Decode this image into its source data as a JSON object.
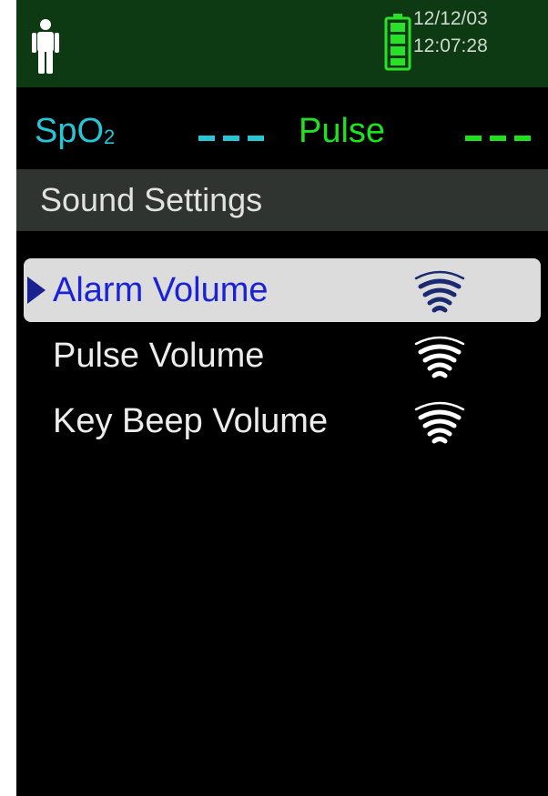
{
  "status": {
    "date": "12/12/03",
    "time": "12:07:28",
    "icons": [
      "person-icon",
      "battery-full-icon"
    ],
    "battery_color": "#2ae02a"
  },
  "vitals": {
    "spo2_label": "SpO",
    "spo2_sub": "2",
    "spo2_value": "---",
    "spo2_color": "#27c6d6",
    "pulse_label": "Pulse",
    "pulse_value": "---",
    "pulse_color": "#1fe21f"
  },
  "header": {
    "title": "Sound Settings"
  },
  "menu": {
    "items": [
      {
        "label": "Alarm Volume",
        "selected": true,
        "icon": "volume-icon"
      },
      {
        "label": "Pulse Volume",
        "selected": false,
        "icon": "volume-icon"
      },
      {
        "label": "Key Beep Volume",
        "selected": false,
        "icon": "volume-icon"
      }
    ],
    "selected_color": "#1a22d8",
    "highlight_color": "#dcdcdc"
  }
}
